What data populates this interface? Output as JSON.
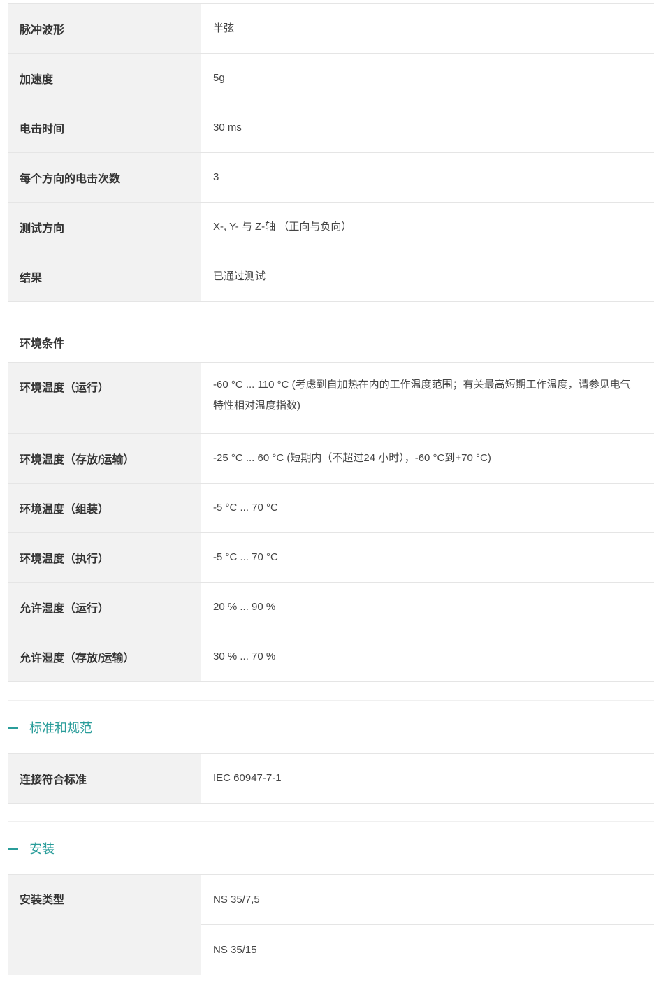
{
  "shock_table": {
    "rows": [
      {
        "label": "脉冲波形",
        "value": "半弦"
      },
      {
        "label": "加速度",
        "value": "5g"
      },
      {
        "label": "电击时间",
        "value": "30 ms"
      },
      {
        "label": "每个方向的电击次数",
        "value": "3"
      },
      {
        "label": "测试方向",
        "value": "X-, Y- 与 Z-轴 （正向与负向）"
      },
      {
        "label": "结果",
        "value": "已通过测试"
      }
    ]
  },
  "environment": {
    "subheading": "环境条件",
    "rows": [
      {
        "label": "环境温度（运行）",
        "value": "-60 °C ... 110 °C (考虑到自加热在内的工作温度范围；有关最高短期工作温度，请参见电气特性相对温度指数)"
      },
      {
        "label": "环境温度（存放/运输）",
        "value": "-25 °C ... 60 °C (短期内（不超过24 小时），-60 °C到+70 °C)"
      },
      {
        "label": "环境温度（组装）",
        "value": "-5 °C ... 70 °C"
      },
      {
        "label": "环境温度（执行）",
        "value": "-5 °C ... 70 °C"
      },
      {
        "label": "允许湿度（运行）",
        "value": "20 % ... 90 %"
      },
      {
        "label": "允许湿度（存放/运输）",
        "value": "30 % ... 70 %"
      }
    ]
  },
  "standards": {
    "title": "标准和规范",
    "rows": [
      {
        "label": "连接符合标准",
        "value": "IEC 60947-7-1"
      }
    ]
  },
  "installation": {
    "title": "安装",
    "label": "安装类型",
    "values": [
      "NS 35/7,5",
      "NS 35/15"
    ]
  },
  "colors": {
    "accent": "#2a9d9a",
    "label_bg": "#f2f2f2"
  }
}
